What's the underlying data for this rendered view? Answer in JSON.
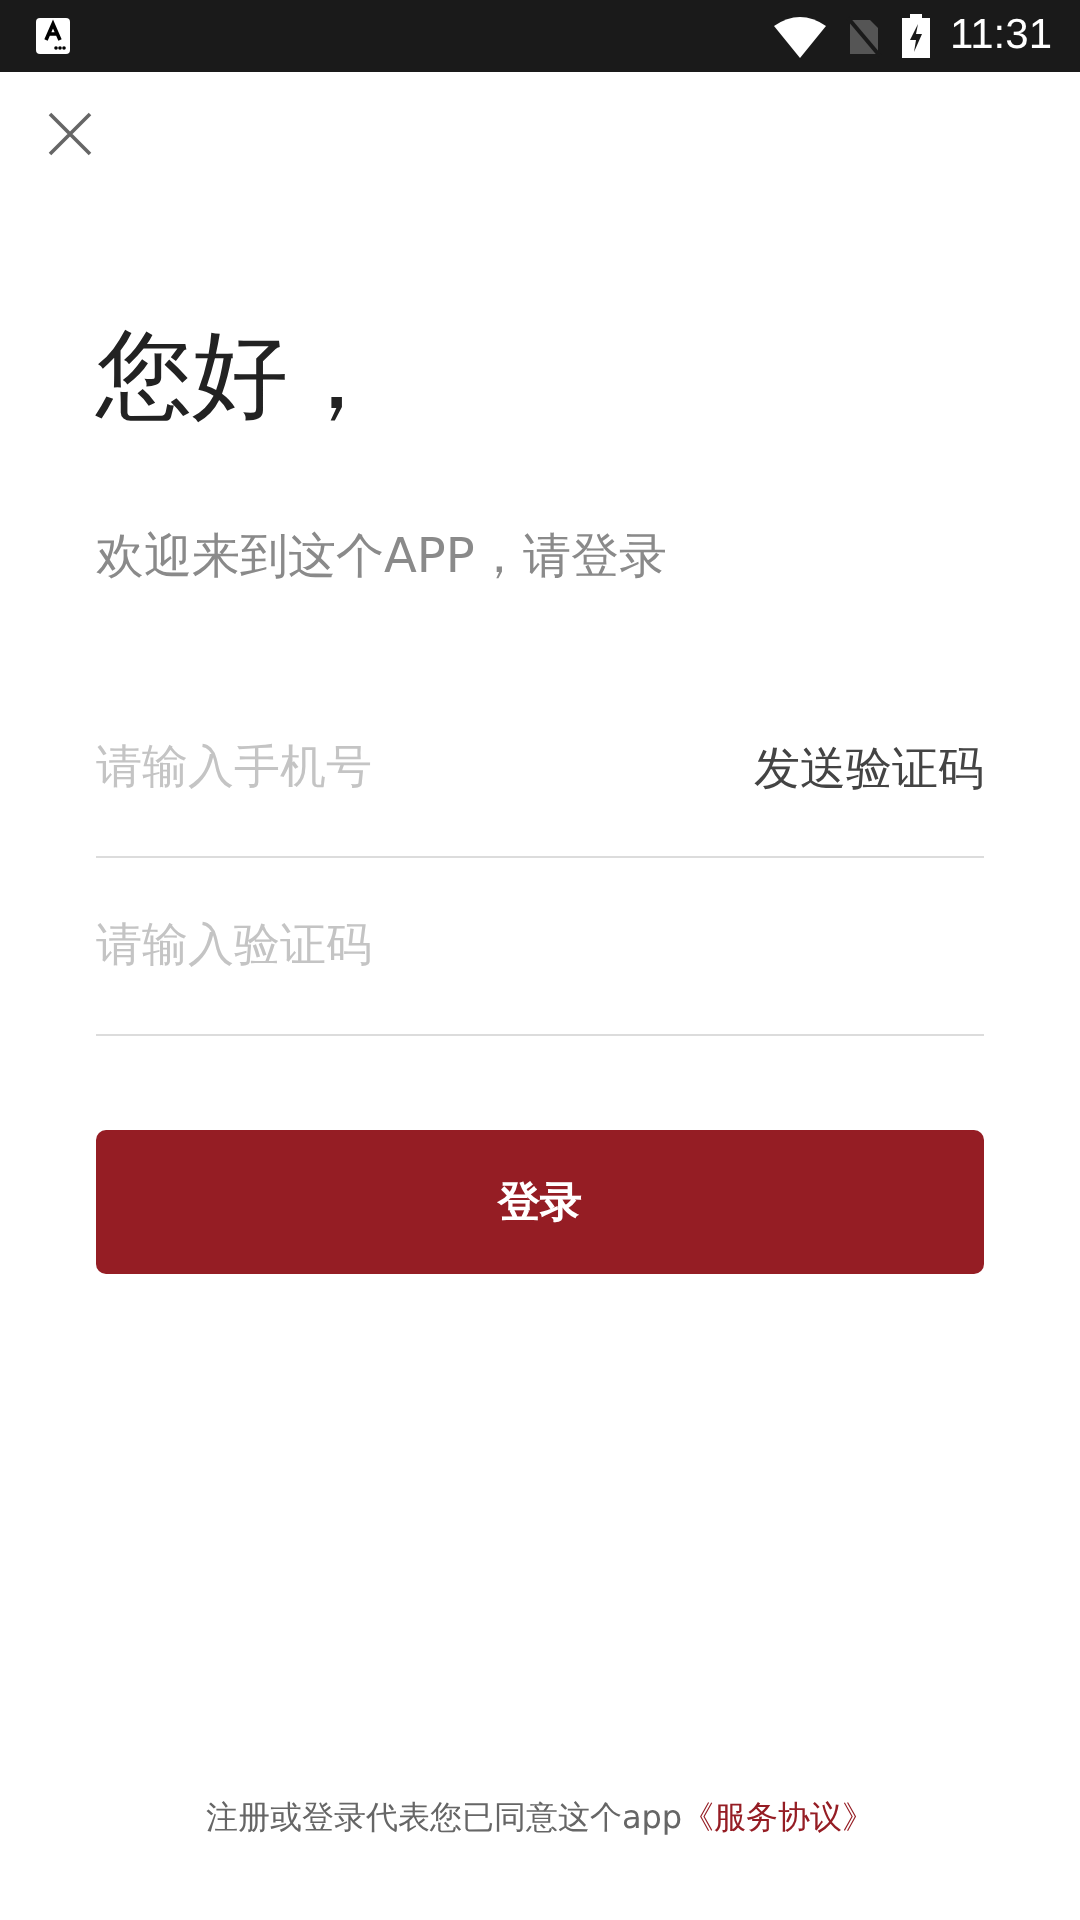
{
  "status_bar": {
    "time": "11:31"
  },
  "greeting": "您好，",
  "subtitle": "欢迎来到这个APP，请登录",
  "phone_field": {
    "placeholder": "请输入手机号",
    "action": "发送验证码"
  },
  "code_field": {
    "placeholder": "请输入验证码"
  },
  "login_button": "登录",
  "footer": {
    "text": "注册或登录代表您已同意这个app",
    "link": "《服务协议》"
  }
}
